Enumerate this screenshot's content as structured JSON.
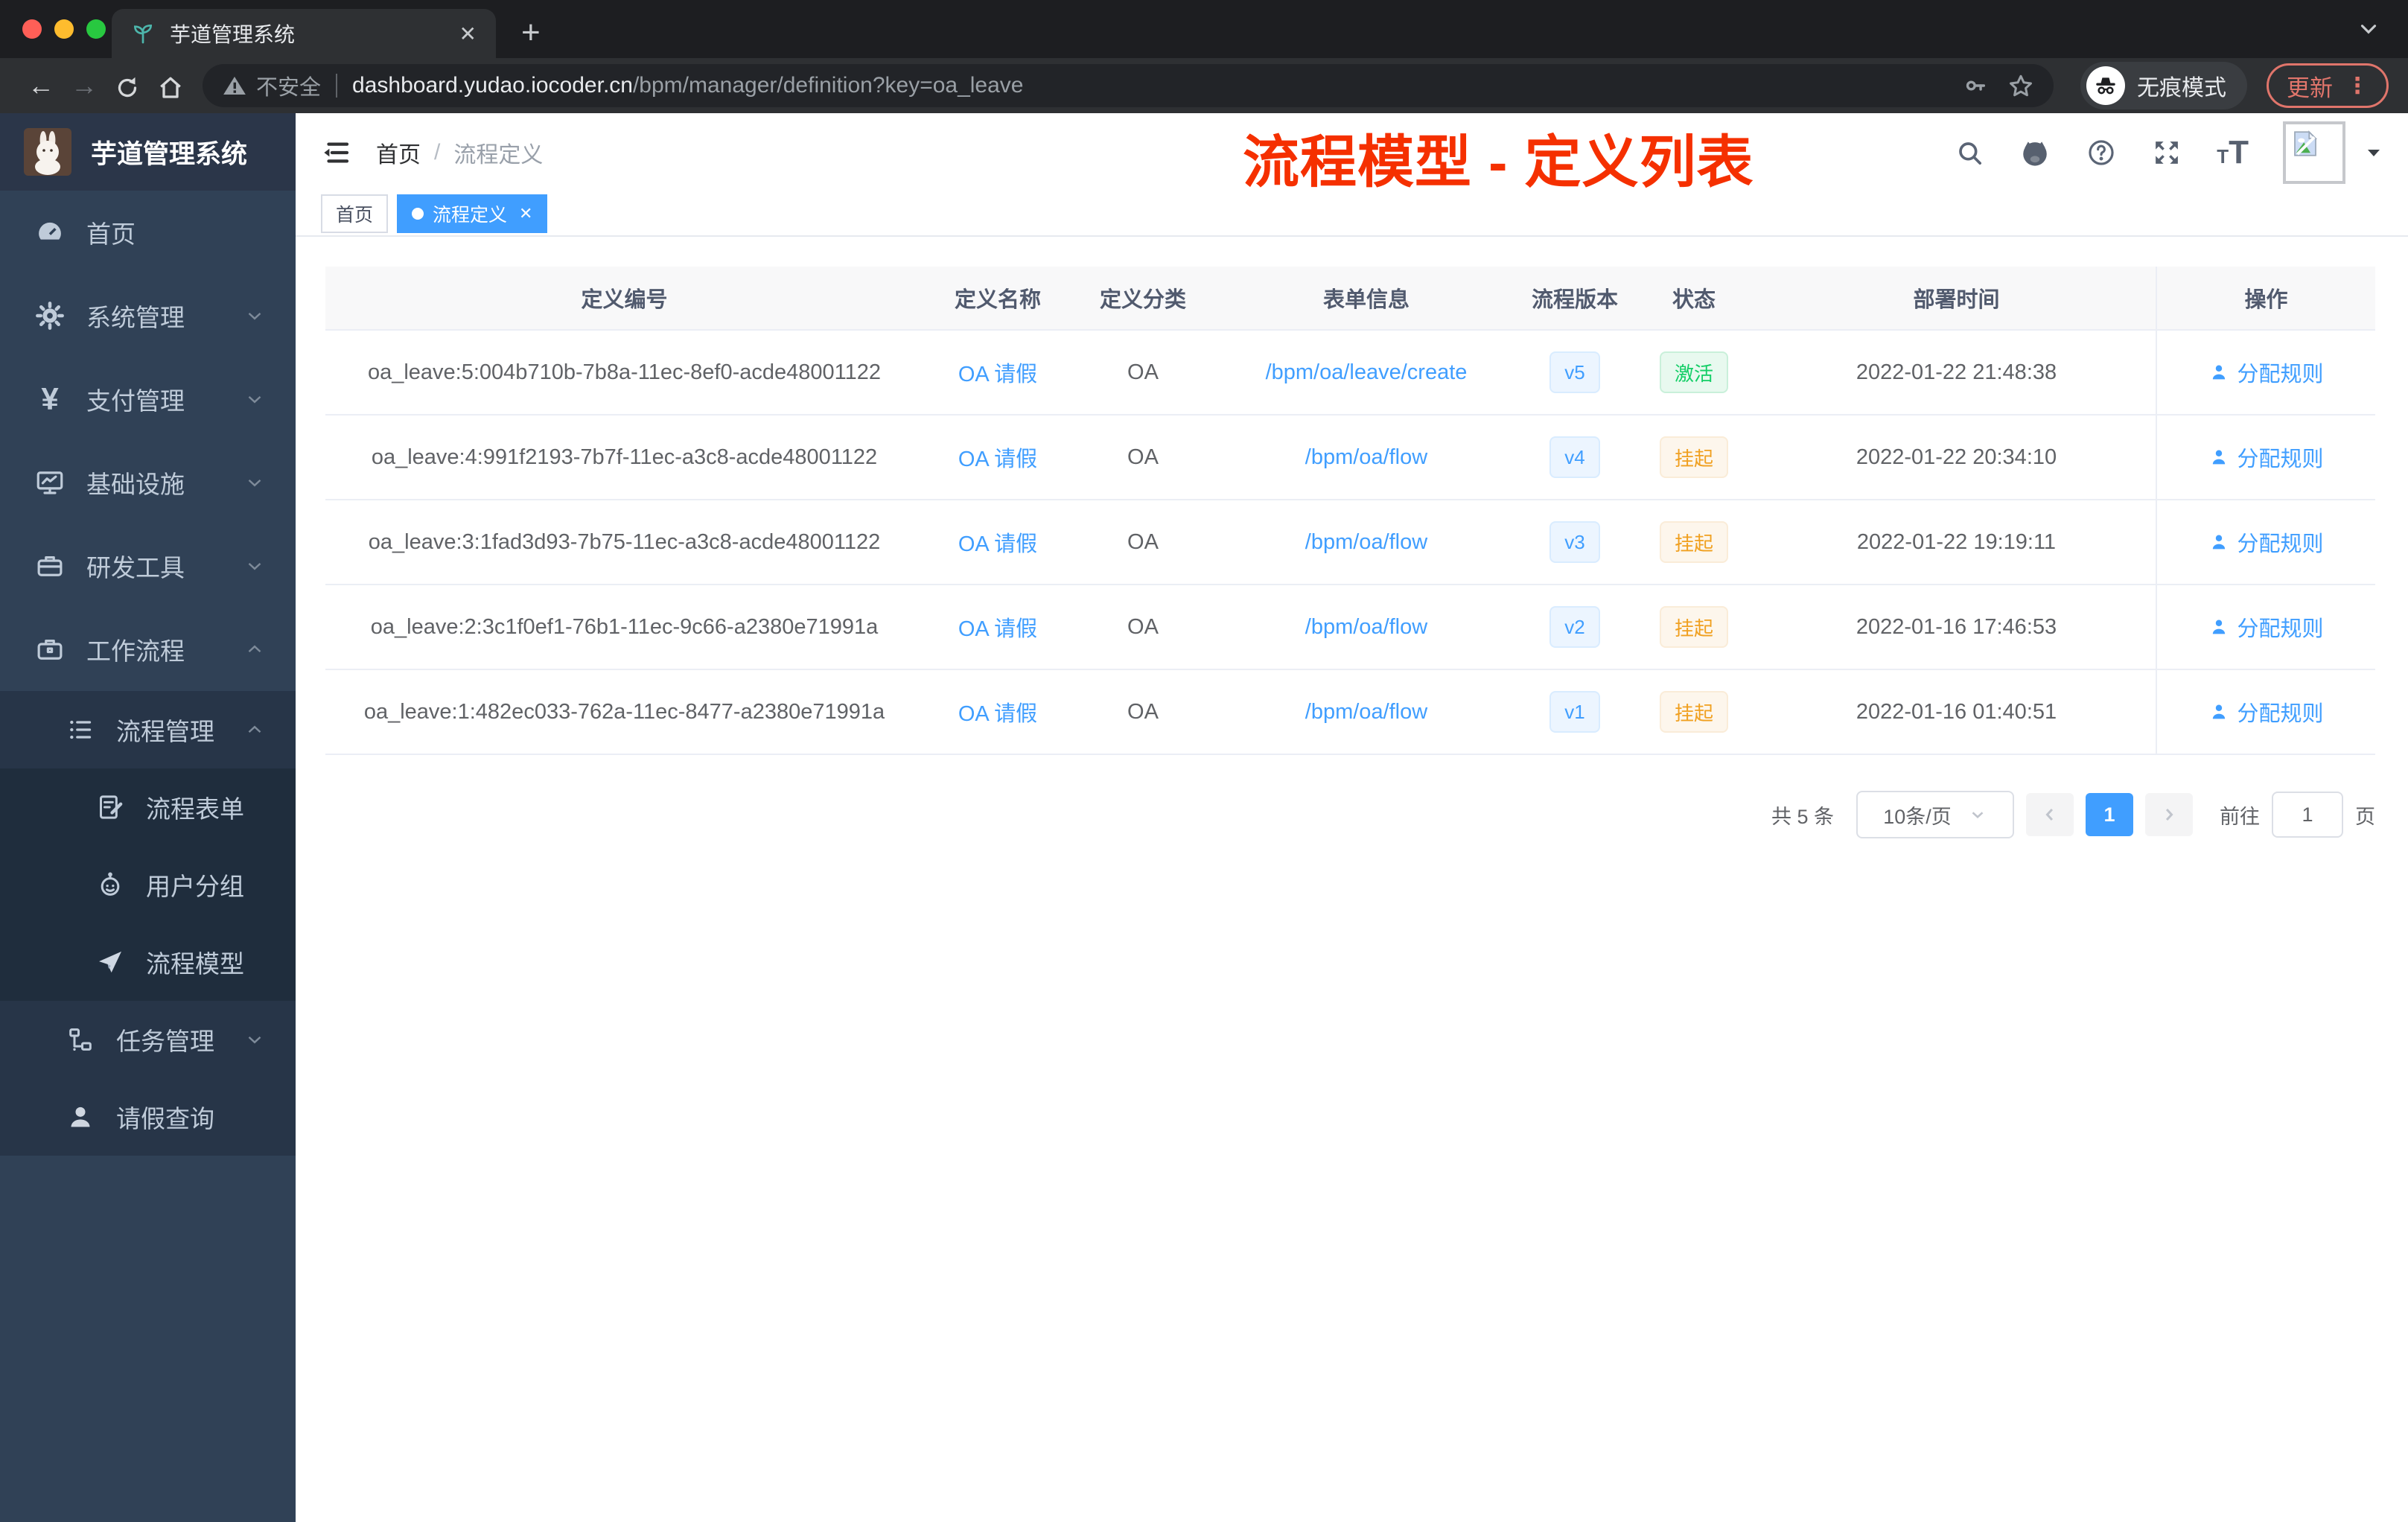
{
  "browser": {
    "tab_title": "芋道管理系统",
    "security_label": "不安全",
    "url_domain": "dashboard.yudao.iocoder.cn",
    "url_path": "/bpm/manager/definition?key=oa_leave",
    "incognito_label": "无痕模式",
    "update_label": "更新"
  },
  "sidebar": {
    "app_title": "芋道管理系统",
    "items": [
      {
        "label": "首页",
        "icon": "dashboard-icon",
        "chevron": null
      },
      {
        "label": "系统管理",
        "icon": "gear-icon",
        "chevron": "down"
      },
      {
        "label": "支付管理",
        "icon": "yen-icon",
        "chevron": "down"
      },
      {
        "label": "基础设施",
        "icon": "monitor-icon",
        "chevron": "down"
      },
      {
        "label": "研发工具",
        "icon": "toolbox-icon",
        "chevron": "down"
      },
      {
        "label": "工作流程",
        "icon": "briefcase-icon",
        "chevron": "up"
      },
      {
        "label": "流程管理",
        "icon": "list-icon",
        "chevron": "up"
      },
      {
        "label": "流程表单",
        "icon": "form-icon",
        "chevron": null
      },
      {
        "label": "用户分组",
        "icon": "robot-icon",
        "chevron": null
      },
      {
        "label": "流程模型",
        "icon": "paper-plane-icon",
        "chevron": null
      },
      {
        "label": "任务管理",
        "icon": "tree-icon",
        "chevron": "down"
      },
      {
        "label": "请假查询",
        "icon": "user-icon",
        "chevron": null
      }
    ]
  },
  "header": {
    "breadcrumb": [
      "首页",
      "流程定义"
    ],
    "breadcrumb_separator": "/",
    "overlay_title": "流程模型 - 定义列表"
  },
  "tags": [
    {
      "label": "首页",
      "active": false
    },
    {
      "label": "流程定义",
      "active": true
    }
  ],
  "table": {
    "columns": [
      "定义编号",
      "定义名称",
      "定义分类",
      "表单信息",
      "流程版本",
      "状态",
      "部署时间",
      "操作"
    ],
    "rows": [
      {
        "id": "oa_leave:5:004b710b-7b8a-11ec-8ef0-acde48001122",
        "name": "OA 请假",
        "category": "OA",
        "form": "/bpm/oa/leave/create",
        "version": "v5",
        "status": "激活",
        "time": "2022-01-22 21:48:38",
        "action": "分配规则"
      },
      {
        "id": "oa_leave:4:991f2193-7b7f-11ec-a3c8-acde48001122",
        "name": "OA 请假",
        "category": "OA",
        "form": "/bpm/oa/flow",
        "version": "v4",
        "status": "挂起",
        "time": "2022-01-22 20:34:10",
        "action": "分配规则"
      },
      {
        "id": "oa_leave:3:1fad3d93-7b75-11ec-a3c8-acde48001122",
        "name": "OA 请假",
        "category": "OA",
        "form": "/bpm/oa/flow",
        "version": "v3",
        "status": "挂起",
        "time": "2022-01-22 19:19:11",
        "action": "分配规则"
      },
      {
        "id": "oa_leave:2:3c1f0ef1-76b1-11ec-9c66-a2380e71991a",
        "name": "OA 请假",
        "category": "OA",
        "form": "/bpm/oa/flow",
        "version": "v2",
        "status": "挂起",
        "time": "2022-01-16 17:46:53",
        "action": "分配规则"
      },
      {
        "id": "oa_leave:1:482ec033-762a-11ec-8477-a2380e71991a",
        "name": "OA 请假",
        "category": "OA",
        "form": "/bpm/oa/flow",
        "version": "v1",
        "status": "挂起",
        "time": "2022-01-16 01:40:51",
        "action": "分配规则"
      }
    ]
  },
  "pagination": {
    "total": "共 5 条",
    "page_size": "10条/页",
    "current_page": "1",
    "goto_prefix": "前往",
    "goto_value": "1",
    "goto_suffix": "页"
  },
  "colors": {
    "accent": "#409eff",
    "overlay_title_red": "#f53000",
    "status_active_green": "#13ce66",
    "status_suspended_yellow": "#f0a020",
    "sidebar_bg": "#304156"
  }
}
